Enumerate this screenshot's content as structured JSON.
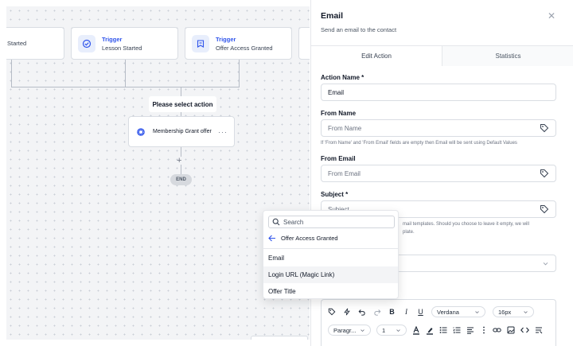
{
  "canvas": {
    "triggers": [
      {
        "label": "",
        "name": "Started"
      },
      {
        "label": "Trigger",
        "name": "Lesson Started"
      },
      {
        "label": "Trigger",
        "name": "Offer Access Granted"
      }
    ],
    "select_action": "Please select action",
    "action_card": {
      "name": "Membership Grant offer",
      "menu": "···"
    },
    "plus": "+",
    "end": "END"
  },
  "panel": {
    "title": "Email",
    "subtitle": "Send an email to the contact",
    "close": "✕",
    "tabs": [
      {
        "label": "Edit Action"
      },
      {
        "label": "Statistics"
      }
    ],
    "fields": {
      "action_name": {
        "label": "Action Name *",
        "value": "Email"
      },
      "from_name": {
        "label": "From Name",
        "placeholder": "From Name",
        "hint": "If 'From Name' and 'From Email' fields are empty then Email will be sent using Default Values"
      },
      "from_email": {
        "label": "From Email",
        "placeholder": "From Email"
      },
      "subject": {
        "label": "Subject *",
        "placeholder": "Subject",
        "hint_line1": "mail templates. Should you choose to leave it empty, we will",
        "hint_line2": "plate."
      }
    },
    "editor": {
      "row1": {
        "bold": "B",
        "italic": "I",
        "underline": "U",
        "font": "Verdana",
        "size": "16px"
      },
      "row2": {
        "paragraph": "Paragr...",
        "line_height": "1"
      }
    }
  },
  "dropdown": {
    "search_placeholder": "Search",
    "back_label": "Offer Access Granted",
    "items": [
      {
        "label": "Email"
      },
      {
        "label": "Login URL (Magic Link)"
      },
      {
        "label": "Offer Title"
      }
    ]
  },
  "colors": {
    "accent": "#2f54eb",
    "canvas_bg": "#f3f4f6",
    "border": "#d9dde3"
  }
}
